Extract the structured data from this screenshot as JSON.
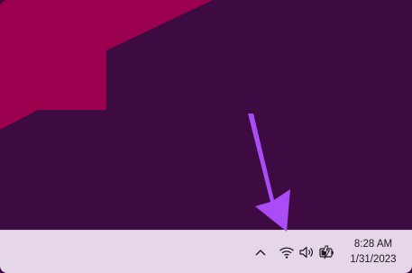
{
  "wallpaper": {
    "background_color": "#3d0b41",
    "accent_color": "#9b004e"
  },
  "annotation": {
    "arrow_color": "#a94cf5"
  },
  "taskbar": {
    "background_color": "#e6d6ea",
    "tray": {
      "show_hidden_icons": "chevron-up-icon",
      "network": "wifi-icon",
      "volume": "speaker-icon",
      "battery": "battery-charging-icon"
    },
    "clock": {
      "time": "8:28 AM",
      "date": "1/31/2023"
    }
  }
}
